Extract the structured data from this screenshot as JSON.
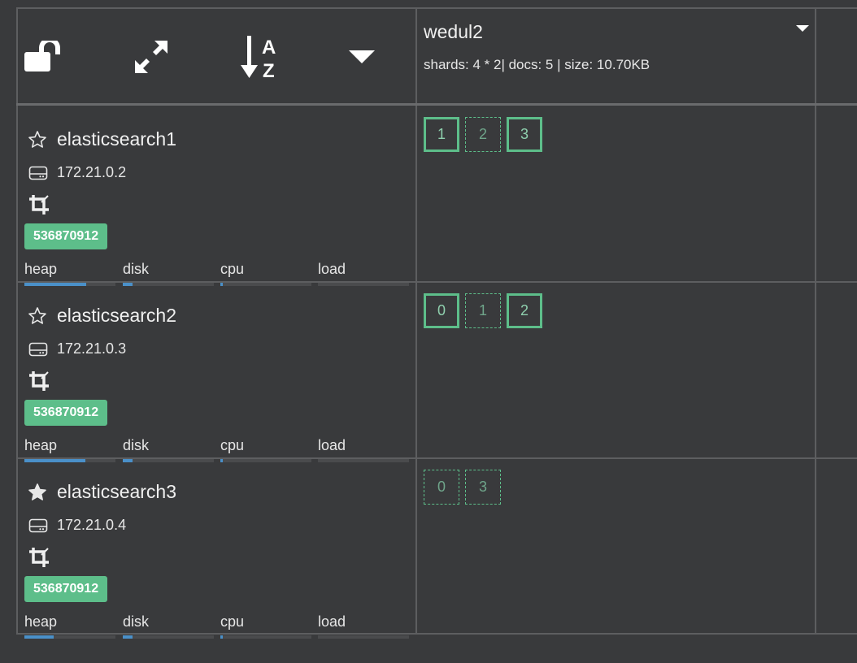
{
  "toolbar": {
    "lock_icon": "unlock-icon",
    "expand_icon": "expand-icon",
    "sort_icon": "sort-alpha-icon",
    "menu_icon": "caret-down-icon"
  },
  "index": {
    "name": "wedul2",
    "stats": "shards: 4 * 2| docs: 5 | size: 10.70KB"
  },
  "nodes": [
    {
      "name": "elasticsearch1",
      "master": false,
      "ip": "172.21.0.2",
      "badge": "536870912",
      "metrics": [
        {
          "label": "heap",
          "value": 0.68
        },
        {
          "label": "disk",
          "value": 0.11
        },
        {
          "label": "cpu",
          "value": 0.03
        },
        {
          "label": "load",
          "value": 0.0
        }
      ],
      "shards": [
        {
          "label": "1",
          "kind": "primary"
        },
        {
          "label": "2",
          "kind": "replica"
        },
        {
          "label": "3",
          "kind": "primary"
        }
      ]
    },
    {
      "name": "elasticsearch2",
      "master": false,
      "ip": "172.21.0.3",
      "badge": "536870912",
      "metrics": [
        {
          "label": "heap",
          "value": 0.67
        },
        {
          "label": "disk",
          "value": 0.11
        },
        {
          "label": "cpu",
          "value": 0.03
        },
        {
          "label": "load",
          "value": 0.0
        }
      ],
      "shards": [
        {
          "label": "0",
          "kind": "primary"
        },
        {
          "label": "1",
          "kind": "replica"
        },
        {
          "label": "2",
          "kind": "primary"
        }
      ]
    },
    {
      "name": "elasticsearch3",
      "master": true,
      "ip": "172.21.0.4",
      "badge": "536870912",
      "metrics": [
        {
          "label": "heap",
          "value": 0.32
        },
        {
          "label": "disk",
          "value": 0.11
        },
        {
          "label": "cpu",
          "value": 0.03
        },
        {
          "label": "load",
          "value": 0.0
        }
      ],
      "shards": [
        {
          "label": "0",
          "kind": "replica"
        },
        {
          "label": "3",
          "kind": "replica"
        }
      ]
    }
  ],
  "colors": {
    "background": "#393a3c",
    "grid_line": "#5d5e60",
    "badge": "#5dbe8a",
    "shard_border": "#5dbe8a",
    "bar_fill": "#4a90c9",
    "bar_track": "#4a4b4d"
  }
}
